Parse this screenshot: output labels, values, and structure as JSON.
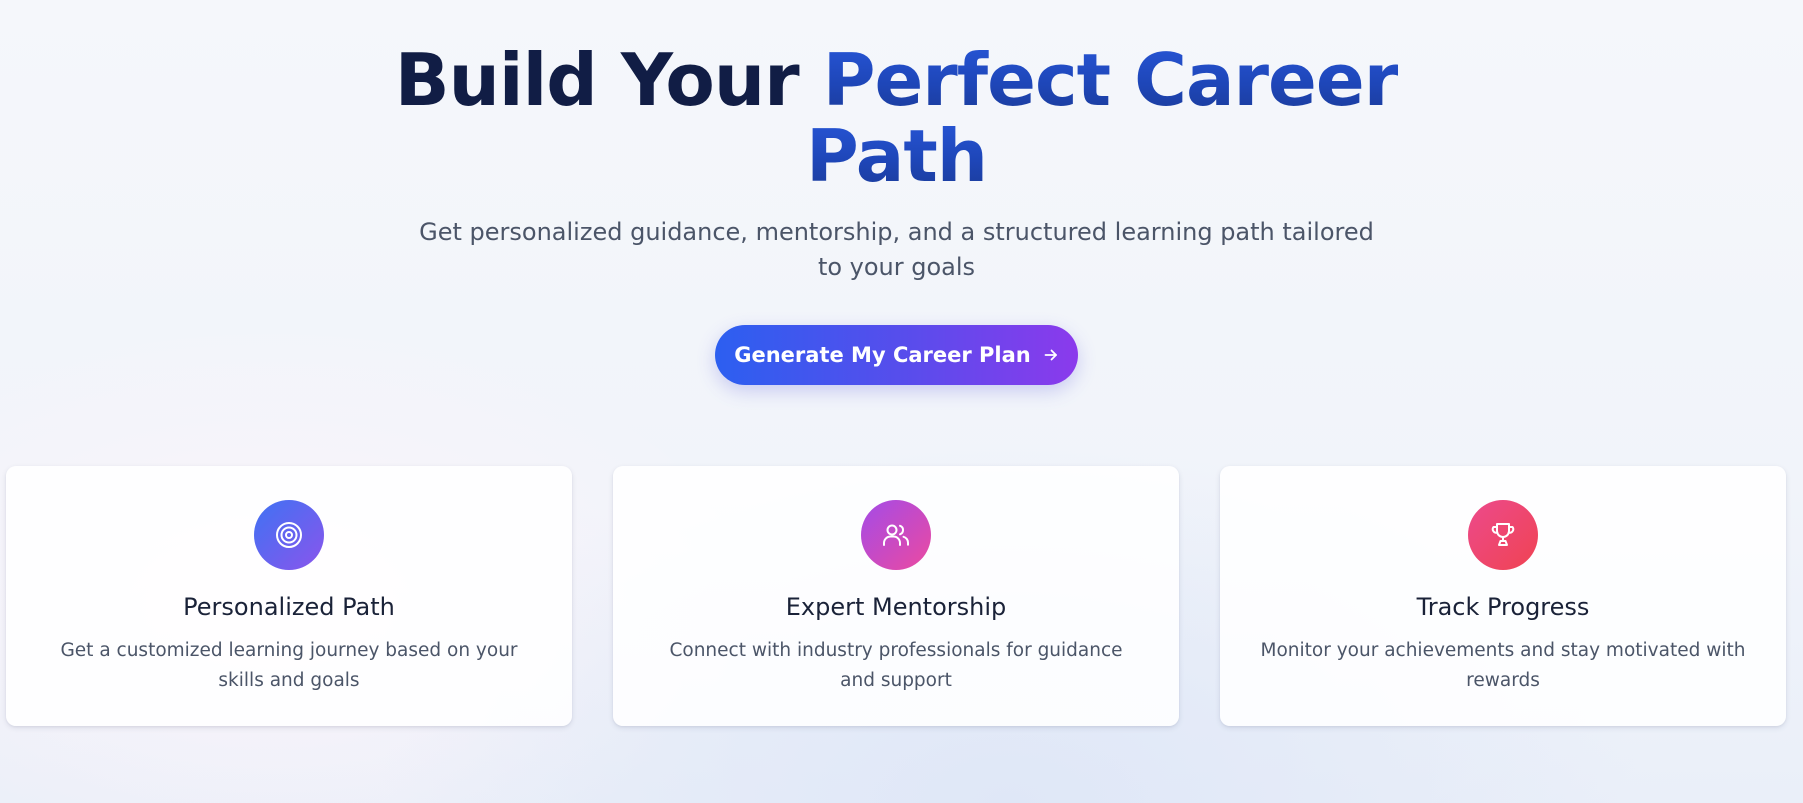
{
  "hero": {
    "headline_dark": "Build Your",
    "headline_accent_1": "Perfect Career",
    "headline_accent_2": "Path",
    "subtitle": "Get personalized guidance, mentorship, and a structured learning path tailored to your goals",
    "cta_label": "Generate My Career Plan",
    "cta_icon": "arrow-right-icon"
  },
  "features": [
    {
      "title": "Personalized Path",
      "description": "Get a customized learning journey based on your skills and goals",
      "icon": "target-icon",
      "gradient": [
        "#3f72f3",
        "#8a55ec"
      ]
    },
    {
      "title": "Expert Mentorship",
      "description": "Connect with industry professionals for guidance and support",
      "icon": "users-icon",
      "gradient": [
        "#a34be8",
        "#ec4aa0"
      ]
    },
    {
      "title": "Track Progress",
      "description": "Monitor your achievements and stay motivated with rewards",
      "icon": "trophy-icon",
      "gradient": [
        "#ec4a8c",
        "#f04352"
      ]
    }
  ],
  "colors": {
    "headline_dark": "#111d45",
    "headline_accent": "#2857d9",
    "cta_start": "#2c5ff0",
    "cta_end": "#8b3aec"
  }
}
